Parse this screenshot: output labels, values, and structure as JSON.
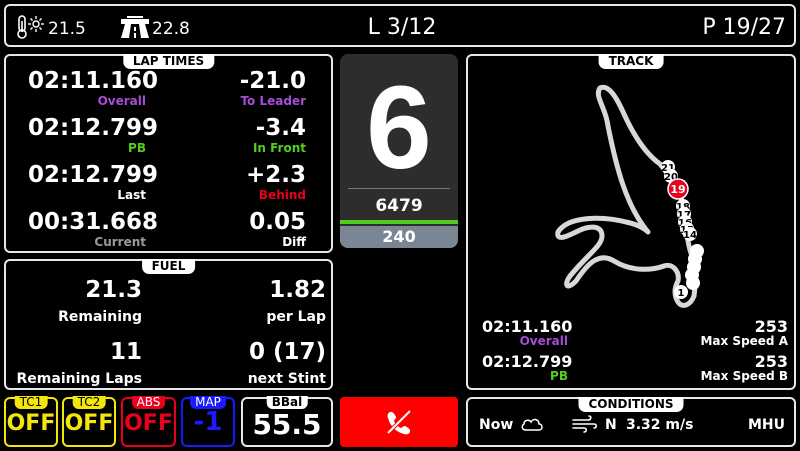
{
  "topbar": {
    "air_temp": "21.5",
    "track_temp": "22.8",
    "lap": "L 3/12",
    "position": "P 19/27"
  },
  "lap_times": {
    "title": "LAP TIMES",
    "overall_time": "02:11.160",
    "overall_label": "Overall",
    "to_leader": "-21.0",
    "to_leader_label": "To Leader",
    "pb_time": "02:12.799",
    "pb_label": "PB",
    "in_front": "-3.4",
    "in_front_label": "In Front",
    "last_time": "02:12.799",
    "last_label": "Last",
    "behind": "+2.3",
    "behind_label": "Behind",
    "current_time": "00:31.668",
    "current_label": "Current",
    "diff": "0.05",
    "diff_label": "Diff"
  },
  "fuel": {
    "title": "FUEL",
    "remaining": "21.3",
    "remaining_label": "Remaining",
    "per_lap": "1.82",
    "per_lap_label": "per Lap",
    "remaining_laps": "11",
    "remaining_laps_label": "Remaining Laps",
    "next_stint": "0 (17)",
    "next_stint_label": "next Stint"
  },
  "gear_panel": {
    "gear": "6",
    "rpm": "6479",
    "speed": "240"
  },
  "track": {
    "title": "TRACK",
    "overall_time": "02:11.160",
    "overall_label": "Overall",
    "pb_time": "02:12.799",
    "pb_label": "PB",
    "max_speed_a": "253",
    "max_speed_a_label": "Max Speed A",
    "max_speed_b": "253",
    "max_speed_b_label": "Max Speed B",
    "player_position": "19",
    "car_markers": [
      "21",
      "20",
      "18",
      "17",
      "16",
      "15",
      "14",
      "1"
    ]
  },
  "controls": {
    "tc1_label": "TC1",
    "tc1_value": "OFF",
    "tc2_label": "TC2",
    "tc2_value": "OFF",
    "abs_label": "ABS",
    "abs_value": "OFF",
    "map_label": "MAP",
    "map_value": "-1",
    "bbal_label": "BBal",
    "bbal_value": "55.5"
  },
  "conditions": {
    "title": "CONDITIONS",
    "time": "Now",
    "wind_dir": "N",
    "wind_speed": "3.32 m/s",
    "humidity_label": "MHU"
  },
  "colors": {
    "overall": "#a64dd6",
    "pb": "#55cc22",
    "behind": "#e8001c",
    "tc": "#f2e60a",
    "abs": "#e8001c",
    "map": "#1a1aff",
    "call_button": "#ff0000",
    "current_label": "#9a9a9a"
  },
  "icons": [
    "thermometer-sun-icon",
    "road-icon",
    "phone-off-icon",
    "cloud-icon",
    "wind-icon"
  ]
}
